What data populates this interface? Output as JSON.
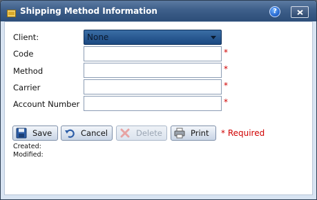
{
  "window": {
    "title": "Shipping Method Information",
    "help_label": "?",
    "close_icon": "close-icon"
  },
  "form": {
    "client_label": "Client:",
    "client_value": "None",
    "code_label": "Code",
    "code_value": "",
    "method_label": "Method",
    "method_value": "",
    "carrier_label": "Carrier",
    "carrier_value": "",
    "account_label": "Account Number",
    "account_value": "",
    "required_marker": "*"
  },
  "toolbar": {
    "save_label": "Save",
    "cancel_label": "Cancel",
    "delete_label": "Delete",
    "print_label": "Print",
    "required_note": "* Required"
  },
  "meta": {
    "created_label": "Created:",
    "modified_label": "Modified:"
  },
  "colors": {
    "titlebar": "#3e5f8a",
    "required": "#d00000",
    "select_bg": "#2a5a92"
  }
}
